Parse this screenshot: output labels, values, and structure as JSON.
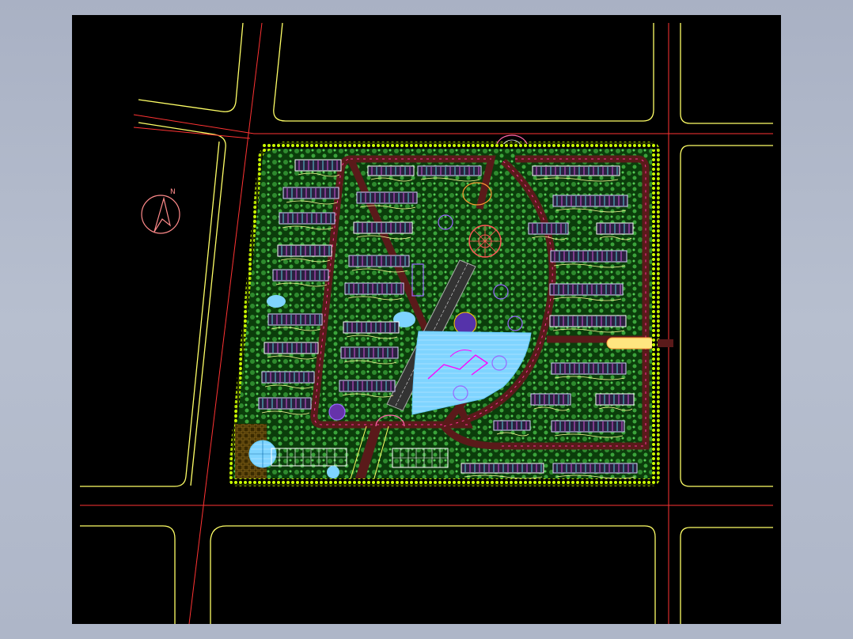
{
  "drawing": {
    "title": "",
    "north_label": "N"
  },
  "colors": {
    "canvas_background": "#000000",
    "frame_background": "#b0b8c9",
    "road_edge": "#ffff66",
    "road_centerline": "#ff3333",
    "site_boundary": "#ccff00",
    "landscape": "#2e8b2e",
    "water": "#7fd4ff",
    "building_outline": "#e0e0ff",
    "highlight": "#ff00ff"
  },
  "icons": {
    "north_arrow": "north-arrow-icon"
  }
}
